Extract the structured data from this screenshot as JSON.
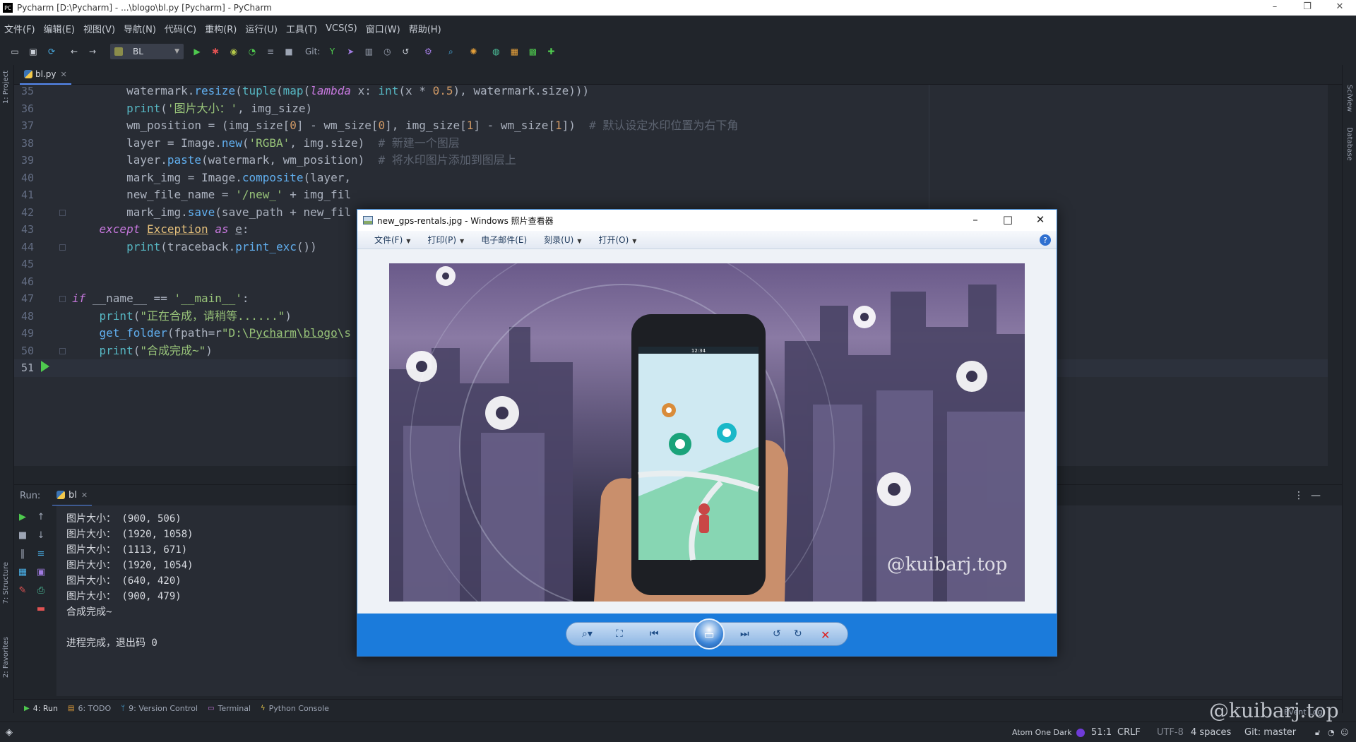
{
  "window": {
    "title": "Pycharm [D:\\Pycharm] - ...\\blogo\\bl.py [Pycharm] - PyCharm",
    "app_logo": "PC"
  },
  "menu": [
    "文件(F)",
    "编辑(E)",
    "视图(V)",
    "导航(N)",
    "代码(C)",
    "重构(R)",
    "运行(U)",
    "工具(T)",
    "VCS(S)",
    "窗口(W)",
    "帮助(H)"
  ],
  "toolbar": {
    "run_config": "BL",
    "git_label": "Git:"
  },
  "left_strip": {
    "project": "1: Project",
    "structure": "7: Structure",
    "favorites": "2: Favorites"
  },
  "right_strip": {
    "sciview": "SciView",
    "database": "Database"
  },
  "editor_tab": {
    "name": "bl.py"
  },
  "code_lines": [
    {
      "n": "35",
      "html": "        watermark.<span class=\"fn\">resize</span>(<span class=\"bi\">tuple</span>(<span class=\"bi\">map</span>(<span class=\"kw\">lambda</span> x: <span class=\"bi\">int</span>(x * <span class=\"nm\">0.5</span>), watermark.size)))"
    },
    {
      "n": "36",
      "html": "        <span class=\"bi\">print</span>(<span class=\"st\">'图片大小：'</span>, img_size)"
    },
    {
      "n": "37",
      "html": "        wm_position = (img_size[<span class=\"nm\">0</span>] - wm_size[<span class=\"nm\">0</span>], img_size[<span class=\"nm\">1</span>] - wm_size[<span class=\"nm\">1</span>])  <span class=\"cm\"># 默认设定水印位置为右下角</span>"
    },
    {
      "n": "38",
      "html": "        layer = Image.<span class=\"fn\">new</span>(<span class=\"st\">'RGBA'</span>, img.size)  <span class=\"cm\"># 新建一个图层</span>"
    },
    {
      "n": "39",
      "html": "        layer.<span class=\"fn\">paste</span>(watermark, wm_position)  <span class=\"cm\"># 将水印图片添加到图层上</span>"
    },
    {
      "n": "40",
      "html": "        mark_img = Image.<span class=\"fn\">composite</span>(layer,"
    },
    {
      "n": "41",
      "html": "        new_file_name = <span class=\"st\">'/new_'</span> + img_fil"
    },
    {
      "n": "42",
      "html": "        mark_img.<span class=\"fn\">save</span>(save_path + new_fil"
    },
    {
      "n": "43",
      "html": "    <span class=\"kw\">except</span> <span class=\"cls\">Exception</span> <span class=\"kw\">as</span> <span class=\"ul\">e</span>:"
    },
    {
      "n": "44",
      "html": "        <span class=\"bi\">print</span>(traceback.<span class=\"fn\">print_exc</span>())"
    },
    {
      "n": "45",
      "html": ""
    },
    {
      "n": "46",
      "html": ""
    },
    {
      "n": "47",
      "html": "<span class=\"kw\">if</span> __name__ == <span class=\"st\">'__main__'</span>:"
    },
    {
      "n": "48",
      "html": "    <span class=\"bi\">print</span>(<span class=\"st\">\"正在合成，请稍等......\"</span>)"
    },
    {
      "n": "49",
      "html": "    <span class=\"fn\">get_folder</span>(fpath=r<span class=\"st\">\"D:\\<span class=\"ul\">Pycharm</span>\\<span class=\"ul\">blogo</span>\\s</span>"
    },
    {
      "n": "50",
      "html": "    <span class=\"bi\">print</span>(<span class=\"st\">\"合成完成~\"</span>)"
    },
    {
      "n": "51",
      "html": ""
    }
  ],
  "run_panel": {
    "label": "Run:",
    "tab": "bl",
    "output": [
      "图片大小： (900, 506)",
      "图片大小： (1920, 1058)",
      "图片大小： (1113, 671)",
      "图片大小： (1920, 1054)",
      "图片大小： (640, 420)",
      "图片大小： (900, 479)",
      "合成完成~",
      "",
      "进程完成，退出码 0"
    ]
  },
  "bottom_tabs": [
    {
      "icon": "run-icon",
      "label": "4: Run"
    },
    {
      "icon": "todo-icon",
      "label": "6: TODO"
    },
    {
      "icon": "version-control-icon",
      "label": "9: Version Control"
    },
    {
      "icon": "terminal-icon",
      "label": "Terminal"
    },
    {
      "icon": "python-console-icon",
      "label": "Python Console"
    }
  ],
  "statusbar": {
    "theme": "Atom One Dark",
    "position": "51:1",
    "line_sep": "CRLF",
    "encoding": "UTF-8",
    "indent": "4 spaces",
    "git_branch": "Git: master",
    "event_log": "Event Log"
  },
  "watermark_text": "@kuibarj.top",
  "viewer": {
    "title": "new_gps-rentals.jpg - Windows 照片查看器",
    "menu": [
      "文件(F)",
      "打印(P)",
      "电子邮件(E)",
      "刻录(U)",
      "打开(O)"
    ],
    "help": "?",
    "photo_watermark": "@kuibarj.top",
    "phone_time": "12:34"
  },
  "colors": {
    "accent": "#568af2",
    "run_green": "#4ec94e",
    "viewer_blue": "#1b7bdb",
    "theme_dot": "#6f3bd8"
  }
}
